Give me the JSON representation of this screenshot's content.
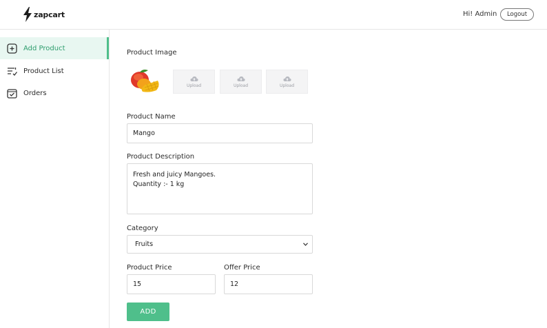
{
  "header": {
    "logo_text": "zapcart",
    "greeting": "Hi! Admin",
    "logout_label": "Logout"
  },
  "sidebar": {
    "items": [
      {
        "label": "Add Product",
        "icon": "add-square-icon",
        "active": true
      },
      {
        "label": "Product List",
        "icon": "list-check-icon",
        "active": false
      },
      {
        "label": "Orders",
        "icon": "orders-check-icon",
        "active": false
      }
    ]
  },
  "form": {
    "image_section_label": "Product Image",
    "upload_label": "Upload",
    "name_label": "Product Name",
    "name_value": "Mango",
    "description_label": "Product Description",
    "description_lines": [
      "Fresh and juicy Mangoes.",
      "Quantity :- 1 kg"
    ],
    "category_label": "Category",
    "category_value": "Fruits",
    "price_label": "Product Price",
    "price_value": "15",
    "offer_label": "Offer Price",
    "offer_value": "12",
    "submit_label": "ADD"
  },
  "colors": {
    "accent": "#4fbf8b",
    "active_bg": "#e8f7f1"
  }
}
